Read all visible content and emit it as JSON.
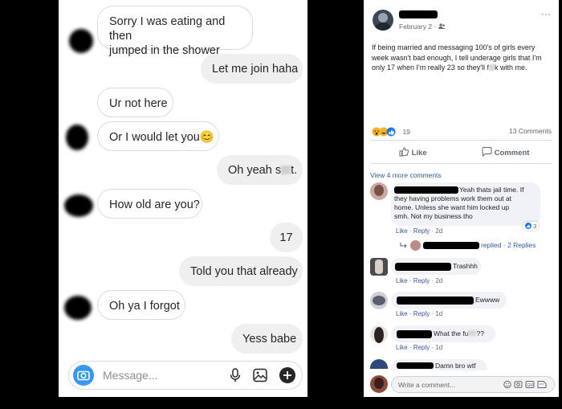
{
  "chat": {
    "messages": [
      {
        "side": "in",
        "line1": "Sorry I was eating and then",
        "line2": "jumped in the shower"
      },
      {
        "side": "out",
        "text": "Let me join haha"
      },
      {
        "side": "in",
        "text": "Ur not here"
      },
      {
        "side": "in",
        "text": "Or I would let you",
        "emoji": "😊"
      },
      {
        "side": "out",
        "text_before": "Oh yeah s",
        "text_after": "t."
      },
      {
        "side": "in",
        "text": "How old are you?"
      },
      {
        "side": "out",
        "text": "17"
      },
      {
        "side": "out",
        "text": "Told you that already"
      },
      {
        "side": "in",
        "text": "Oh ya I forgot"
      },
      {
        "side": "out",
        "text": "Yess babe"
      }
    ],
    "composer": {
      "placeholder": "Message..."
    }
  },
  "post": {
    "date": "February 2 ·",
    "more": "···",
    "body": "If being married and messaging 100's of girls every week wasn't bad enough, I tell underage girls that I'm only 17 when I'm really 23 so they'll f",
    "body_end": "k with me.",
    "reactions_count": "19",
    "comments_count": "13 Comments",
    "like_label": "Like",
    "comment_label": "Comment",
    "view_more": "View 4 more comments",
    "comments": [
      {
        "text_line1": "Yeah thats jail time. If",
        "text_rest": "they having problems work them out at home. Unless she want him locked up smh. Not my business tho",
        "like_count": "3",
        "meta_like": "Like",
        "meta_reply": "Reply",
        "meta_time": "2d",
        "replies_label": "replied · 2 Replies"
      },
      {
        "text": "Trashhh",
        "meta_like": "Like",
        "meta_reply": "Reply",
        "meta_time": "2d"
      },
      {
        "text": "Ewwww",
        "meta_like": "Like",
        "meta_reply": "Reply",
        "meta_time": "1d"
      },
      {
        "text_before": "What the fu",
        "text_after": "??",
        "meta_like": "Like",
        "meta_reply": "Reply",
        "meta_time": "1d"
      },
      {
        "text": "Damn bro wtf"
      }
    ],
    "write_placeholder": "Write a comment..."
  },
  "colors": {
    "instagram_blue": "#3897f0",
    "fb_link": "#385898",
    "bubble_out": "#efefef",
    "fb_comment_bg": "#f0f2f5"
  }
}
